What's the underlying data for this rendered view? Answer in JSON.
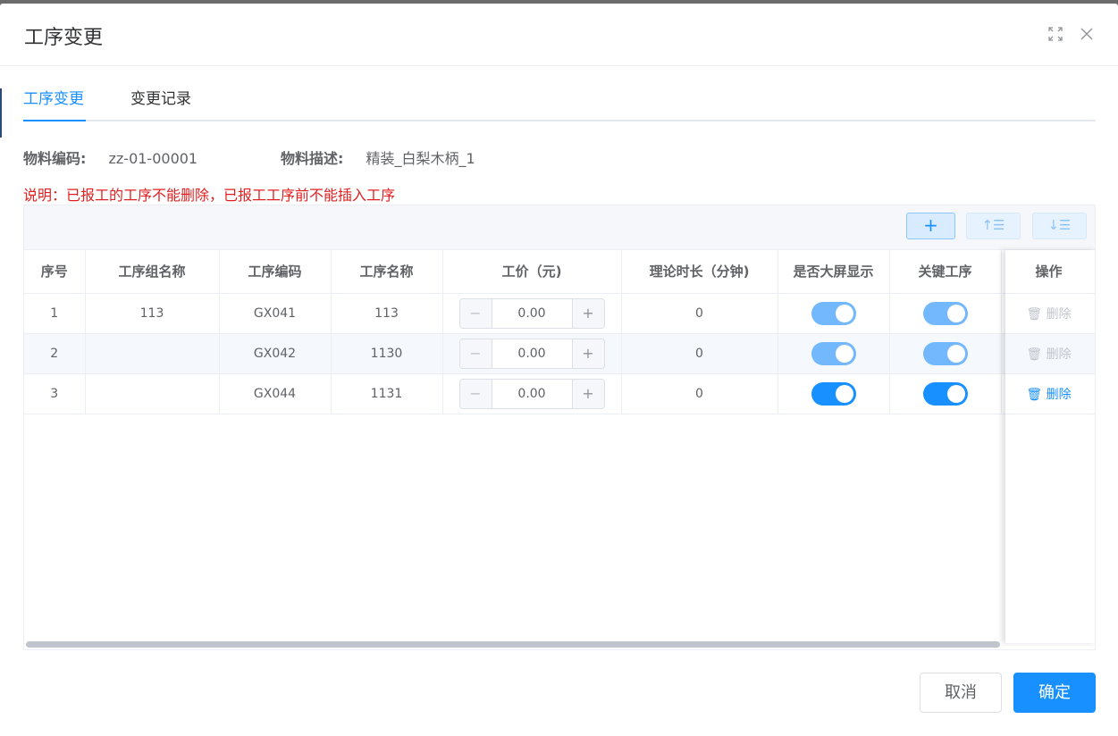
{
  "dialog": {
    "title": "工序变更",
    "expand_icon": "fullscreen-icon",
    "close_icon": "close-icon"
  },
  "tabs": [
    {
      "label": "工序变更",
      "active": true
    },
    {
      "label": "变更记录",
      "active": false
    }
  ],
  "material": {
    "code_label": "物料编码:",
    "code_value": "zz-01-00001",
    "desc_label": "物料描述:",
    "desc_value": "精装_白梨木柄_1"
  },
  "note": "说明：已报工的工序不能删除，已报工工序前不能插入工序",
  "toolbar": {
    "add": "+",
    "move_up": "↑☰",
    "move_down": "↓☰"
  },
  "table": {
    "headers": [
      "序号",
      "工序组名称",
      "工序编码",
      "工序名称",
      "工价（元)",
      "理论时长（分钟)",
      "是否大屏显示",
      "关键工序",
      "操作"
    ],
    "rows": [
      {
        "index": "1",
        "group": "113",
        "code": "GX041",
        "name": "113",
        "price": "0.00",
        "duration": "0",
        "big_screen": true,
        "key": true,
        "locked": true,
        "delete_label": "删除"
      },
      {
        "index": "2",
        "group": "",
        "code": "GX042",
        "name": "1130",
        "price": "0.00",
        "duration": "0",
        "big_screen": true,
        "key": true,
        "locked": true,
        "delete_label": "删除"
      },
      {
        "index": "3",
        "group": "",
        "code": "GX044",
        "name": "1131",
        "price": "0.00",
        "duration": "0",
        "big_screen": true,
        "key": true,
        "locked": false,
        "delete_label": "删除"
      }
    ],
    "stepper_minus": "−",
    "stepper_plus": "+"
  },
  "footer": {
    "cancel": "取消",
    "ok": "确定"
  },
  "colors": {
    "primary": "#1890ff",
    "danger_text": "#e02020",
    "disabled_switch": "#73b8fd"
  }
}
